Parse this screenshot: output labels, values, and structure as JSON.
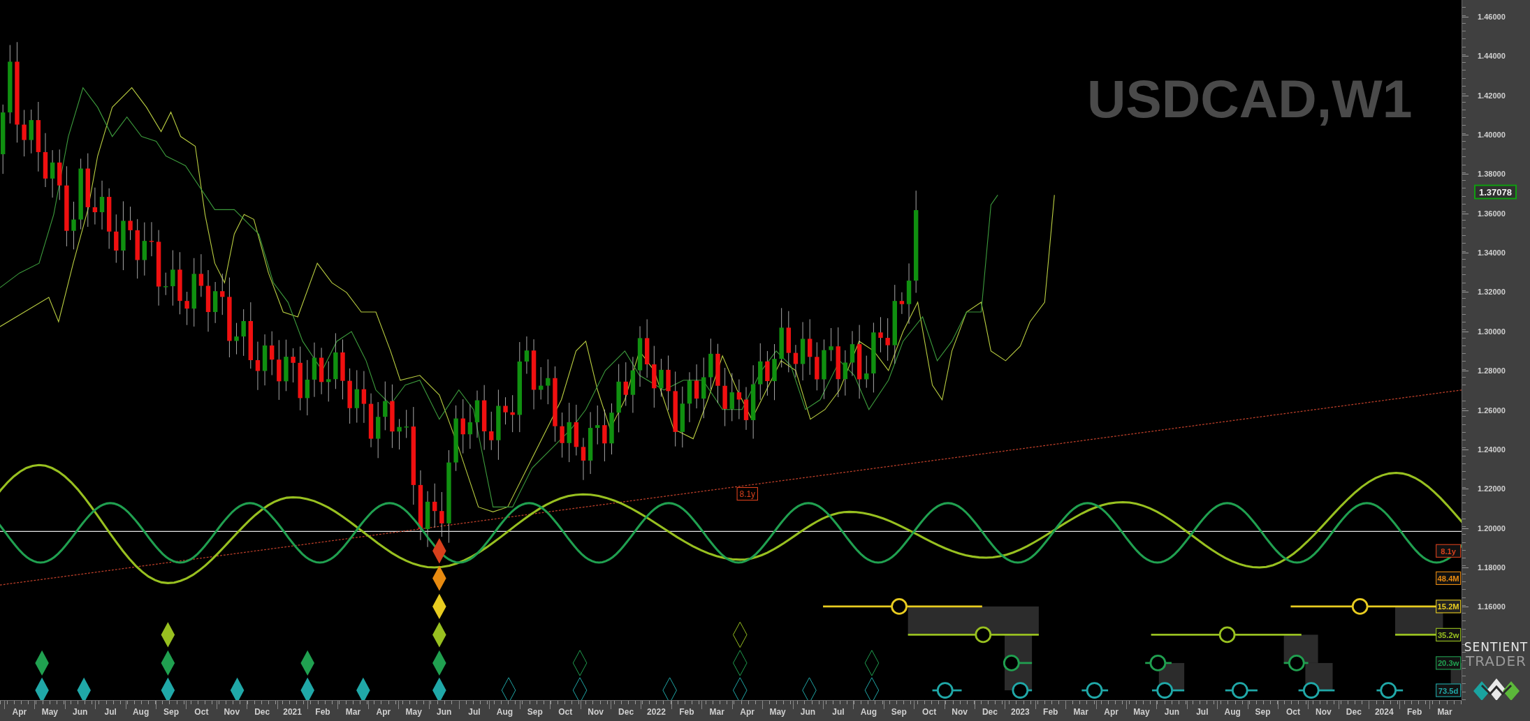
{
  "chart": {
    "symbol": "USDCAD,W1",
    "trendline_label": "8.1y",
    "cycles": [
      {
        "label": "8.1y",
        "color": "#d8401c"
      },
      {
        "label": "48.4M",
        "color": "#e88a10"
      },
      {
        "label": "15.2M",
        "color": "#e8cc20"
      },
      {
        "label": "35.2w",
        "color": "#98c020"
      },
      {
        "label": "20.3w",
        "color": "#20a050"
      },
      {
        "label": "73.5d",
        "color": "#20a8a8"
      }
    ]
  },
  "price_axis": {
    "last_price": "1.37078",
    "ticks": [
      "1.46000",
      "1.44000",
      "1.42000",
      "1.40000",
      "1.38000",
      "1.36000",
      "1.34000",
      "1.32000",
      "1.30000",
      "1.28000",
      "1.26000",
      "1.24000",
      "1.22000",
      "1.20000",
      "1.18000",
      "1.16000"
    ]
  },
  "time_axis": {
    "ticks": [
      "Apr",
      "May",
      "Jun",
      "Jul",
      "Aug",
      "Sep",
      "Oct",
      "Nov",
      "Dec",
      "2021",
      "Feb",
      "Mar",
      "Apr",
      "May",
      "Jun",
      "Jul",
      "Aug",
      "Sep",
      "Oct",
      "Nov",
      "Dec",
      "2022",
      "Feb",
      "Mar",
      "Apr",
      "May",
      "Jun",
      "Jul",
      "Aug",
      "Sep",
      "Oct",
      "Nov",
      "Dec",
      "2023",
      "Feb",
      "Mar",
      "Apr",
      "May",
      "Jun",
      "Jul",
      "Aug",
      "Sep",
      "Oct",
      "Nov",
      "Dec",
      "2024",
      "Feb",
      "Mar"
    ]
  },
  "logo": {
    "line_1": "SENTIENT",
    "line_2": "TRADER"
  }
}
